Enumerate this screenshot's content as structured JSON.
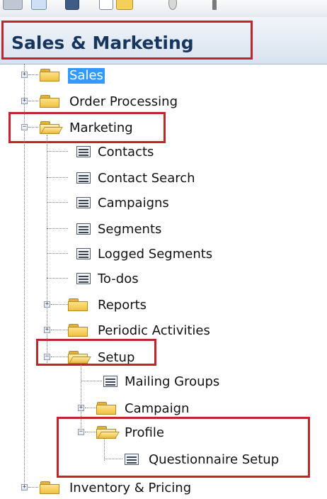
{
  "header": {
    "title": "Sales & Marketing"
  },
  "tree": {
    "sales": "Sales",
    "order_processing": "Order Processing",
    "marketing": "Marketing",
    "contacts": "Contacts",
    "contact_search": "Contact Search",
    "campaigns": "Campaigns",
    "segments": "Segments",
    "logged_segments": "Logged Segments",
    "todos": "To-dos",
    "reports": "Reports",
    "periodic_activities": "Periodic Activities",
    "setup": "Setup",
    "mailing_groups": "Mailing Groups",
    "campaign": "Campaign",
    "profile": "Profile",
    "questionnaire_setup": "Questionnaire Setup",
    "inventory_pricing": "Inventory & Pricing"
  },
  "expander": {
    "collapsed": "+",
    "expanded": "−"
  },
  "colors": {
    "highlight": "#c0252c",
    "selection": "#3399ff",
    "title": "#17365d"
  }
}
